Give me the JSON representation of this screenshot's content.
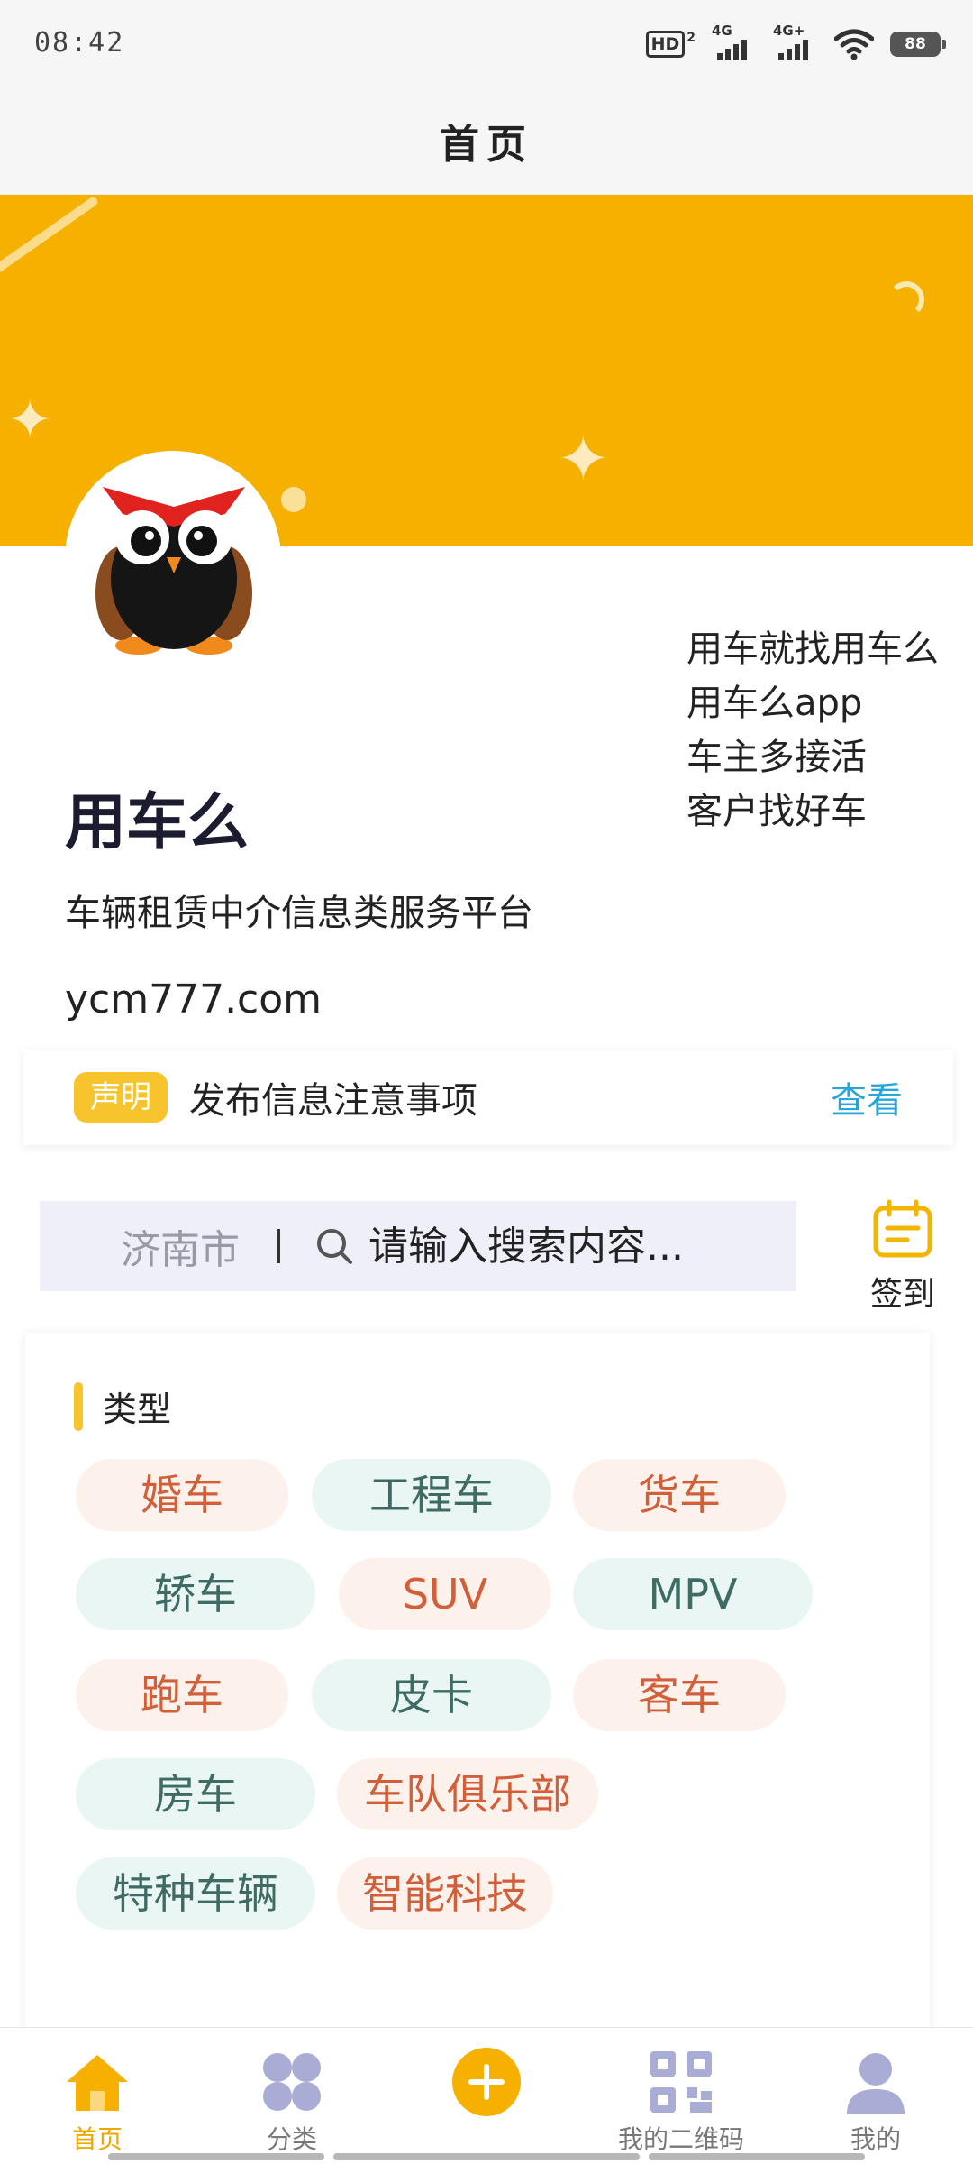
{
  "status_bar": {
    "time": "08:42",
    "hd_label": "HD",
    "hd_sub": "2",
    "sim1_label": "4G",
    "sim2_label": "4G+",
    "battery": "88"
  },
  "header": {
    "title": "首页"
  },
  "profile": {
    "name": "用车么",
    "description": "车辆租赁中介信息类服务平台",
    "url": "ycm777.com",
    "slogans": [
      "用车就找用车么",
      "用车么app",
      "车主多接活",
      "客户找好车"
    ]
  },
  "notice": {
    "badge": "声明",
    "text": "发布信息注意事项",
    "link": "查看"
  },
  "search": {
    "city": "济南市",
    "placeholder": "请输入搜索内容..."
  },
  "checkin": {
    "label": "签到"
  },
  "types": {
    "title": "类型",
    "items": [
      "婚车",
      "工程车",
      "货车",
      "轿车",
      "SUV",
      "MPV",
      "跑车",
      "皮卡",
      "客车",
      "房车",
      "车队俱乐部",
      "特种车辆",
      "智能科技"
    ]
  },
  "bottom_nav": {
    "items": [
      "首页",
      "分类",
      "",
      "我的二维码",
      "我的"
    ],
    "active_index": 0
  },
  "colors": {
    "accent": "#f6b100",
    "link": "#28a6d9",
    "warm_tag_bg": "#fdf1ec",
    "warm_tag_text": "#d1603a",
    "cool_tag_bg": "#eaf6f3",
    "cool_tag_text": "#3f6b65"
  }
}
